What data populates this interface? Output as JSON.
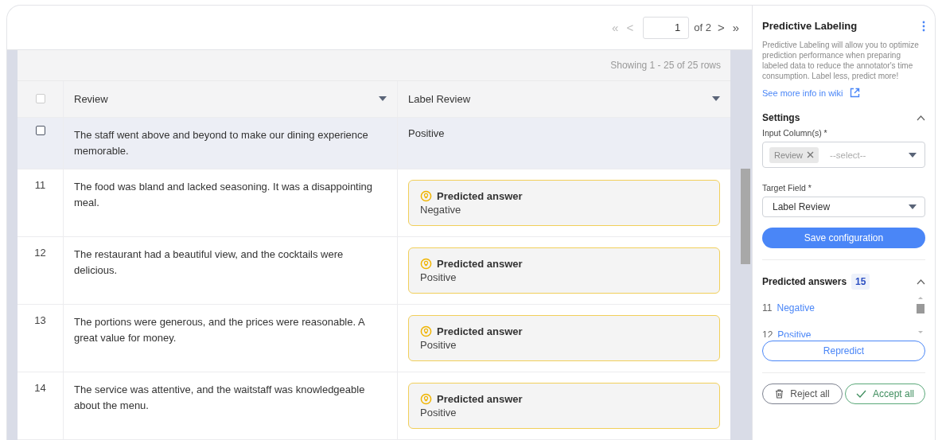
{
  "pager": {
    "first": {
      "label": "«",
      "disabled": true
    },
    "prev": {
      "label": "<",
      "disabled": true
    },
    "page": "1",
    "of": "of 2",
    "next": {
      "label": ">",
      "disabled": false
    },
    "last": {
      "label": "»",
      "disabled": false
    }
  },
  "table": {
    "summary": "Showing 1 - 25 of 25 rows",
    "header_checkbox": {
      "checked": false
    },
    "columns": [
      "Review",
      "Label Review"
    ],
    "rows": [
      {
        "kind": "plain",
        "checked": false,
        "hovered": true,
        "review": "The staff went above and beyond to make our dining experience memorable.",
        "label": "Positive"
      },
      {
        "kind": "predicted",
        "number": "11",
        "hovered": false,
        "review": "The food was bland and lacked seasoning. It was a disappointing meal.",
        "title": "Predicted answer",
        "label": "Negative"
      },
      {
        "kind": "predicted",
        "number": "12",
        "hovered": false,
        "review": "The restaurant had a beautiful view, and the cocktails were delicious.",
        "title": "Predicted answer",
        "label": "Positive"
      },
      {
        "kind": "predicted",
        "number": "13",
        "hovered": false,
        "review": "The portions were generous, and the prices were reasonable. A great value for money.",
        "title": "Predicted answer",
        "label": "Positive"
      },
      {
        "kind": "predicted",
        "number": "14",
        "hovered": false,
        "review": "The service was attentive, and the waitstaff was knowledgeable about the menu.",
        "title": "Predicted answer",
        "label": "Positive"
      }
    ]
  },
  "panel": {
    "title": "Predictive Labeling",
    "description": "Predictive Labeling will allow you to optimize prediction performance when preparing labeled data to reduce the annotator's time consumption. Label less, predict more!",
    "link": "See more info in wiki",
    "settings": {
      "title": "Settings",
      "expanded": true,
      "input_label": "Input Column(s) *",
      "input_tags": [
        "Review"
      ],
      "input_placeholder": "--select--",
      "target_label": "Target Field *",
      "target_value": "Label Review",
      "save": "Save configuration"
    },
    "predicted": {
      "title": "Predicted answers",
      "count": "15",
      "expanded": true,
      "items": [
        {
          "number": "11",
          "label": "Negative"
        },
        {
          "number": "12",
          "label": "Positive"
        }
      ],
      "repredict": "Repredict"
    },
    "reject": "Reject all",
    "accept": "Accept all"
  }
}
